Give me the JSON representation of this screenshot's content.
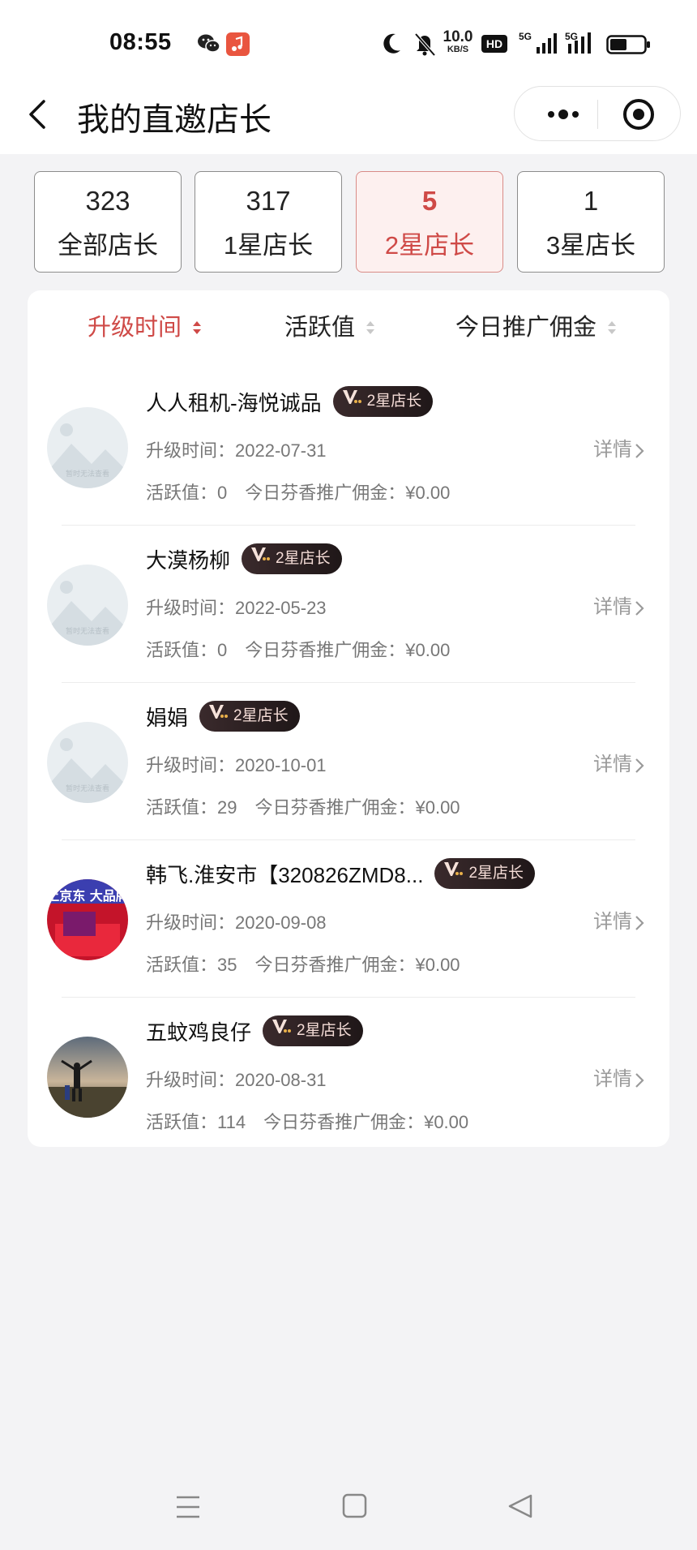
{
  "status_bar": {
    "time": "08:55",
    "net_speed_value": "10.0",
    "net_speed_unit": "KB/S",
    "hd_label": "HD",
    "signal1_label": "5G",
    "signal2_label": "5G",
    "icons": [
      "wechat-icon",
      "music-icon",
      "moon-icon",
      "mute-bell-icon",
      "signal-icon",
      "battery-icon"
    ]
  },
  "header": {
    "title": "我的直邀店长"
  },
  "tabs": [
    {
      "count": "323",
      "label": "全部店长",
      "active": false
    },
    {
      "count": "317",
      "label": "1星店长",
      "active": false
    },
    {
      "count": "5",
      "label": "2星店长",
      "active": true
    },
    {
      "count": "1",
      "label": "3星店长",
      "active": false
    }
  ],
  "sort": [
    {
      "label": "升级时间",
      "active": true
    },
    {
      "label": "活跃值",
      "active": false
    },
    {
      "label": "今日推广佣金",
      "active": false
    }
  ],
  "list": [
    {
      "name": "人人租机-海悦诚品",
      "badge": "2星店长",
      "upgrade": "升级时间：2022-07-31",
      "active": "活跃值：0",
      "commission": "今日芬香推广佣金：¥0.00",
      "detail": "详情",
      "avatar_text": "暂时无法查看"
    },
    {
      "name": "大漠杨柳",
      "badge": "2星店长",
      "upgrade": "升级时间：2022-05-23",
      "active": "活跃值：0",
      "commission": "今日芬香推广佣金：¥0.00",
      "detail": "详情",
      "avatar_text": "暂时无法查看"
    },
    {
      "name": "娟娟",
      "badge": "2星店长",
      "upgrade": "升级时间：2020-10-01",
      "active": "活跃值：29",
      "commission": "今日芬香推广佣金：¥0.00",
      "detail": "详情",
      "avatar_text": "暂时无法查看"
    },
    {
      "name": "韩飞.淮安市【320826ZMD8...",
      "badge": "2星店长",
      "upgrade": "升级时间：2020-09-08",
      "active": "活跃值：35",
      "commission": "今日芬香推广佣金：¥0.00",
      "detail": "详情",
      "avatar_text": "买家电上京东 大品牌真实惠"
    },
    {
      "name": "五蚊鸡良仔",
      "badge": "2星店长",
      "upgrade": "升级时间：2020-08-31",
      "active": "活跃值：114",
      "commission": "今日芬香推广佣金：¥0.00",
      "detail": "详情",
      "avatar_text": ""
    }
  ],
  "colors": {
    "accent": "#cf4a47",
    "active_tab_bg": "#fdf0ef",
    "badge_bg": "#2b2021",
    "page_bg": "#f3f3f5"
  }
}
